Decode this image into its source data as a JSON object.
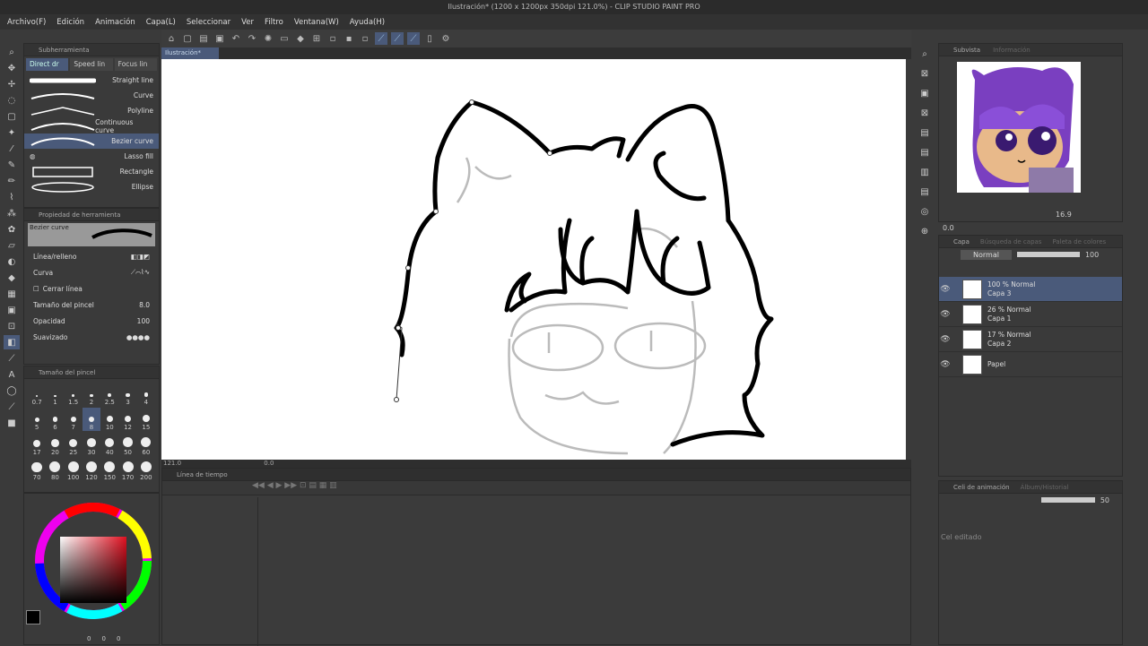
{
  "window_title": "Ilustración* (1200 x 1200px 350dpi 121.0%) - CLIP STUDIO PAINT PRO",
  "menu": [
    "Archivo(F)",
    "Edición",
    "Animación",
    "Capa(L)",
    "Seleccionar",
    "Ver",
    "Filtro",
    "Ventana(W)",
    "Ayuda(H)"
  ],
  "subtool": {
    "header": "Subherramienta",
    "tabs": [
      "Direct dr",
      "Speed lin",
      "Focus lin"
    ],
    "items": [
      {
        "label": "Straight line"
      },
      {
        "label": "Curve"
      },
      {
        "label": "Polyline"
      },
      {
        "label": "Continuous curve"
      },
      {
        "label": "Bezier curve"
      },
      {
        "label": "Lasso fill"
      },
      {
        "label": "Rectangle"
      },
      {
        "label": "Ellipse"
      }
    ]
  },
  "tool_property": {
    "header": "Propiedad de herramienta",
    "preview_label": "Bezier curve",
    "line_fill": "Línea/relleno",
    "curve": "Curva",
    "close_line": "Cerrar línea",
    "brush_size_label": "Tamaño del pincel",
    "brush_size_value": "8.0",
    "opacity_label": "Opacidad",
    "opacity_value": "100",
    "smoothing_label": "Suavizado"
  },
  "brush_size": {
    "header": "Tamaño del pincel",
    "sizes": [
      "0.7",
      "1",
      "1.5",
      "2",
      "2.5",
      "3",
      "4",
      "5",
      "6",
      "7",
      "8",
      "10",
      "12",
      "15",
      "17",
      "20",
      "25",
      "30",
      "40",
      "50",
      "60",
      "70",
      "80",
      "100",
      "120",
      "150",
      "170",
      "200"
    ],
    "selected": "8"
  },
  "color_values": [
    "0",
    "0",
    "0"
  ],
  "canvas": {
    "tab": "Ilustración*",
    "zoom": "121.0",
    "angle": "0.0"
  },
  "timeline": {
    "header": "Línea de tiempo"
  },
  "subview": {
    "tabs": [
      "Subvista",
      "Información"
    ],
    "zoom": "16.9",
    "angle": "0.0"
  },
  "layers": {
    "tabs": [
      "Capa",
      "Búsqueda de capas",
      "Paleta de colores"
    ],
    "blend": "Normal",
    "opacity": "100",
    "list": [
      {
        "pct": "100 % Normal",
        "name": "Capa 3"
      },
      {
        "pct": "26 % Normal",
        "name": "Capa 1"
      },
      {
        "pct": "17 % Normal",
        "name": "Capa 2"
      },
      {
        "pct": "",
        "name": "Papel"
      }
    ]
  },
  "anim": {
    "tabs": [
      "Celi de animación",
      "Álbum/Historial"
    ],
    "opacity": "50",
    "status": "Cel editado"
  },
  "colors": {
    "accent": "#4a5a7a",
    "panel": "#3a3a3a",
    "canvas": "#ffffff",
    "hair": "#7a3fc0"
  }
}
